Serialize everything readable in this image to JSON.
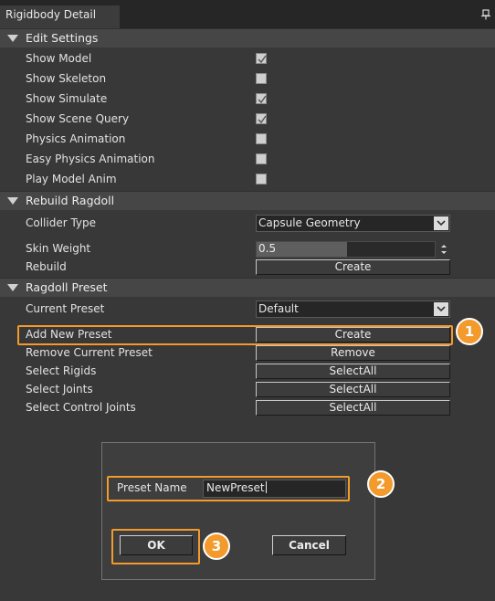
{
  "window": {
    "tab_title": "Rigidbody Detail",
    "pin_icon": "pin-icon"
  },
  "sections": {
    "edit": {
      "title": "Edit Settings"
    },
    "rebuild": {
      "title": "Rebuild Ragdoll"
    },
    "preset": {
      "title": "Ragdoll Preset"
    }
  },
  "edit_settings": [
    {
      "label": "Show Model",
      "checked": true
    },
    {
      "label": "Show Skeleton",
      "checked": false
    },
    {
      "label": "Show Simulate",
      "checked": true
    },
    {
      "label": "Show Scene Query",
      "checked": true
    },
    {
      "label": "Physics Animation",
      "checked": false
    },
    {
      "label": "Easy Physics Animation",
      "checked": false
    },
    {
      "label": "Play Model Anim",
      "checked": false
    }
  ],
  "rebuild": {
    "collider_label": "Collider Type",
    "collider_value": "Capsule Geometry",
    "skin_label": "Skin Weight",
    "skin_value": "0.5",
    "skin_level_percent": 51,
    "rebuild_label": "Rebuild",
    "rebuild_button": "Create"
  },
  "preset": {
    "current_label": "Current Preset",
    "current_value": "Default",
    "add_label": "Add New Preset",
    "add_button": "Create",
    "remove_label": "Remove Current Preset",
    "remove_button": "Remove",
    "rigids_label": "Select Rigids",
    "rigids_button": "SelectAll",
    "joints_label": "Select Joints",
    "joints_button": "SelectAll",
    "control_label": "Select Control Joints",
    "control_button": "SelectAll"
  },
  "dialog": {
    "name_label": "Preset Name",
    "name_value": "NewPreset",
    "ok_button": "OK",
    "cancel_button": "Cancel"
  },
  "callouts": [
    "1",
    "2",
    "3"
  ],
  "colors": {
    "accent": "#f39a2c",
    "panel": "#383838",
    "section": "#464646"
  }
}
